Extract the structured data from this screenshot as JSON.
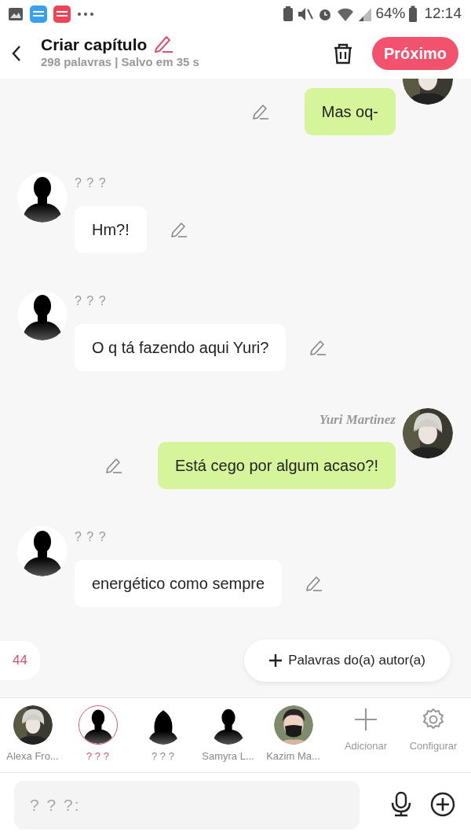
{
  "status_bar": {
    "battery": "64%",
    "time": "12:14"
  },
  "header": {
    "title": "Criar capítulo",
    "subtitle": "298 palavras | Salvo em 35 s",
    "next_button": "Próximo"
  },
  "messages": [
    {
      "kind": "outgoing",
      "text": "Mas oq-"
    },
    {
      "kind": "incoming",
      "avatar": {
        "kind": "silhouette"
      },
      "name": "? ? ?",
      "text": "Hm?!"
    },
    {
      "kind": "incoming",
      "avatar": {
        "kind": "silhouette"
      },
      "name": "? ? ?",
      "text": "O q tá fazendo aqui Yuri?"
    },
    {
      "kind": "outgoing",
      "name": "Yuri Martinez",
      "text": "Está cego por algum acaso?!"
    },
    {
      "kind": "incoming",
      "avatar": {
        "kind": "silhouette"
      },
      "name": "? ? ?",
      "text": "energético como sempre"
    }
  ],
  "counter": "44",
  "author_words_button": "Palavras do(a) autor(a)",
  "characters": [
    {
      "name": "Alexa Fro...",
      "selected": false
    },
    {
      "name": "? ? ?",
      "avatar": {
        "kind": "silhouette"
      },
      "selected": true
    },
    {
      "name": "? ? ?",
      "avatar": {
        "kind": "longhair"
      },
      "selected": false
    },
    {
      "name": "Samyra L...",
      "avatar": {
        "kind": "silhouette"
      },
      "selected": false
    },
    {
      "name": "Kazim Ma...",
      "avatar": {
        "kind": "masked"
      },
      "selected": false
    }
  ],
  "add_button": "Adicionar",
  "settings_button": "Configurar",
  "input": {
    "placeholder": "? ? ?:"
  }
}
